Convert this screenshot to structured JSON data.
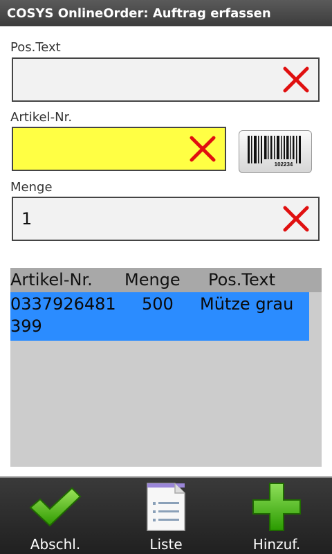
{
  "app": {
    "title": "COSYS OnlineOrder: Auftrag erfassen"
  },
  "form": {
    "pos_text": {
      "label": "Pos.Text",
      "value": ""
    },
    "artikel_nr": {
      "label": "Artikel-Nr.",
      "value": ""
    },
    "menge": {
      "label": "Menge",
      "value": "1"
    },
    "barcode_digits": "102234"
  },
  "list": {
    "headers": [
      "Artikel-Nr.",
      "Menge",
      "Pos.Text"
    ],
    "rows": [
      {
        "artikel_nr_line1": "0337926481",
        "artikel_nr_line2": "399",
        "menge": "500",
        "pos_text": "Mütze grau"
      }
    ]
  },
  "bottom": {
    "finish_label": "Abschl.",
    "list_label": "Liste",
    "add_label": "Hinzuf."
  },
  "colors": {
    "accent_yellow": "#ffff44",
    "selection_blue": "#2b8cff",
    "clear_red": "#e01010",
    "check_green": "#3cb400"
  }
}
